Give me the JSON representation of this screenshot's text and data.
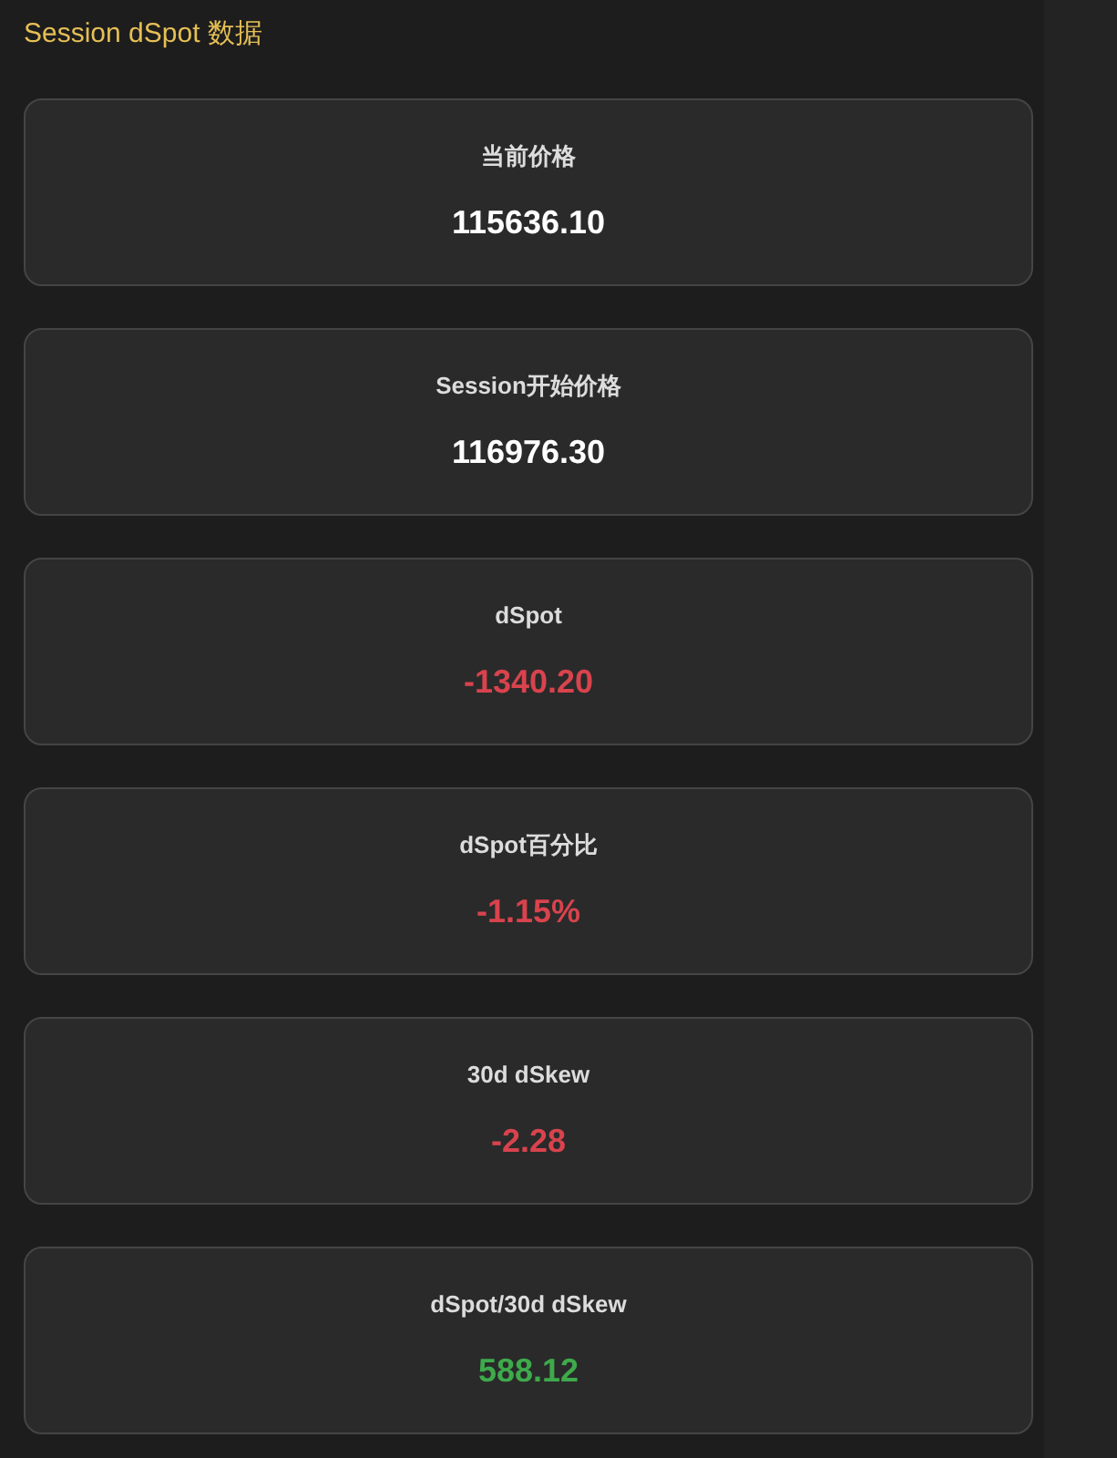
{
  "title": "Session dSpot 数据",
  "metrics": [
    {
      "label": "当前价格",
      "value": "115636.10",
      "color": "#ffffff"
    },
    {
      "label": "Session开始价格",
      "value": "116976.30",
      "color": "#ffffff"
    },
    {
      "label": "dSpot",
      "value": "-1340.20",
      "color": "#d8434d"
    },
    {
      "label": "dSpot百分比",
      "value": "-1.15%",
      "color": "#d8434d"
    },
    {
      "label": "30d dSkew",
      "value": "-2.28",
      "color": "#d8434d"
    },
    {
      "label": "dSpot/30d dSkew",
      "value": "588.12",
      "color": "#3eaa4b"
    }
  ]
}
